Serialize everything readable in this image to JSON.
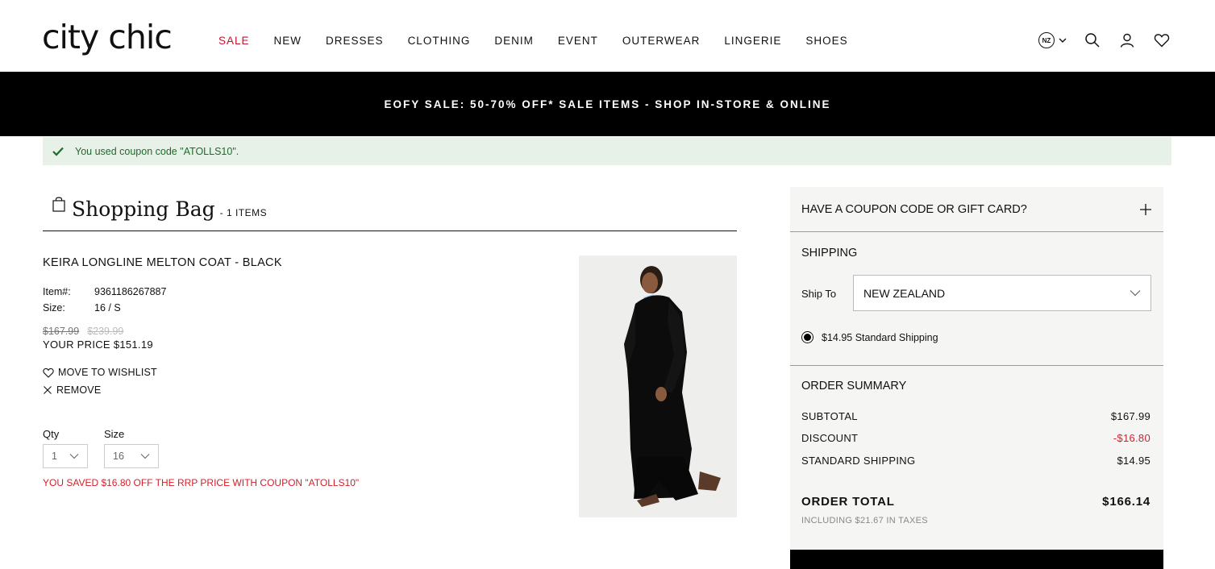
{
  "brand": {
    "logo": "city chic"
  },
  "nav": {
    "items": [
      "SALE",
      "NEW",
      "DRESSES",
      "CLOTHING",
      "DENIM",
      "EVENT",
      "OUTERWEAR",
      "LINGERIE",
      "SHOES"
    ],
    "sale_color": "#c8102e"
  },
  "header_icons": {
    "region": "NZ",
    "icons": [
      "region-selector",
      "search-icon",
      "account-icon",
      "wishlist-icon"
    ]
  },
  "banner": {
    "text": "EOFY SALE: 50-70% OFF* SALE ITEMS - SHOP IN-STORE & ONLINE"
  },
  "notice": {
    "text": "You used coupon code \"ATOLLS10\"."
  },
  "bag": {
    "title": "Shopping Bag",
    "count": "- 1 ITEMS"
  },
  "product": {
    "name": "KEIRA LONGLINE MELTON COAT - BLACK",
    "item_label": "Item#:",
    "item_value": "9361186267887",
    "size_label": "Size:",
    "size_value": "16 / S",
    "price_was": "$167.99",
    "price_rrp": "$239.99",
    "your_price": "YOUR PRICE $151.19",
    "move_to_wishlist": "MOVE TO WISHLIST",
    "remove": "REMOVE",
    "qty_label": "Qty",
    "qty_value": "1",
    "size_select_label": "Size",
    "size_select_value": "16",
    "saved_text": "YOU SAVED $16.80 OFF THE RRP PRICE WITH COUPON \"ATOLLS10\""
  },
  "summary_panel": {
    "coupon_label": "HAVE A COUPON CODE OR GIFT CARD?",
    "shipping_title": "SHIPPING",
    "ship_to_label": "Ship To",
    "ship_to_value": "NEW ZEALAND",
    "shipping_option": "$14.95 Standard Shipping",
    "order_summary_title": "ORDER SUMMARY",
    "rows": [
      {
        "label": "SUBTOTAL",
        "value": "$167.99"
      },
      {
        "label": "DISCOUNT",
        "value": "-$16.80"
      },
      {
        "label": "STANDARD SHIPPING",
        "value": "$14.95"
      }
    ],
    "total_label": "ORDER TOTAL",
    "total_value": "$166.14",
    "tax_note": "INCLUDING $21.67 IN TAXES",
    "discount_color": "#d41f2a"
  },
  "colors": {
    "banner_bg": "#000000",
    "notice_bg": "#e7f1e8",
    "notice_text": "#1e6b2a",
    "panel_bg": "#f5f5f4"
  }
}
